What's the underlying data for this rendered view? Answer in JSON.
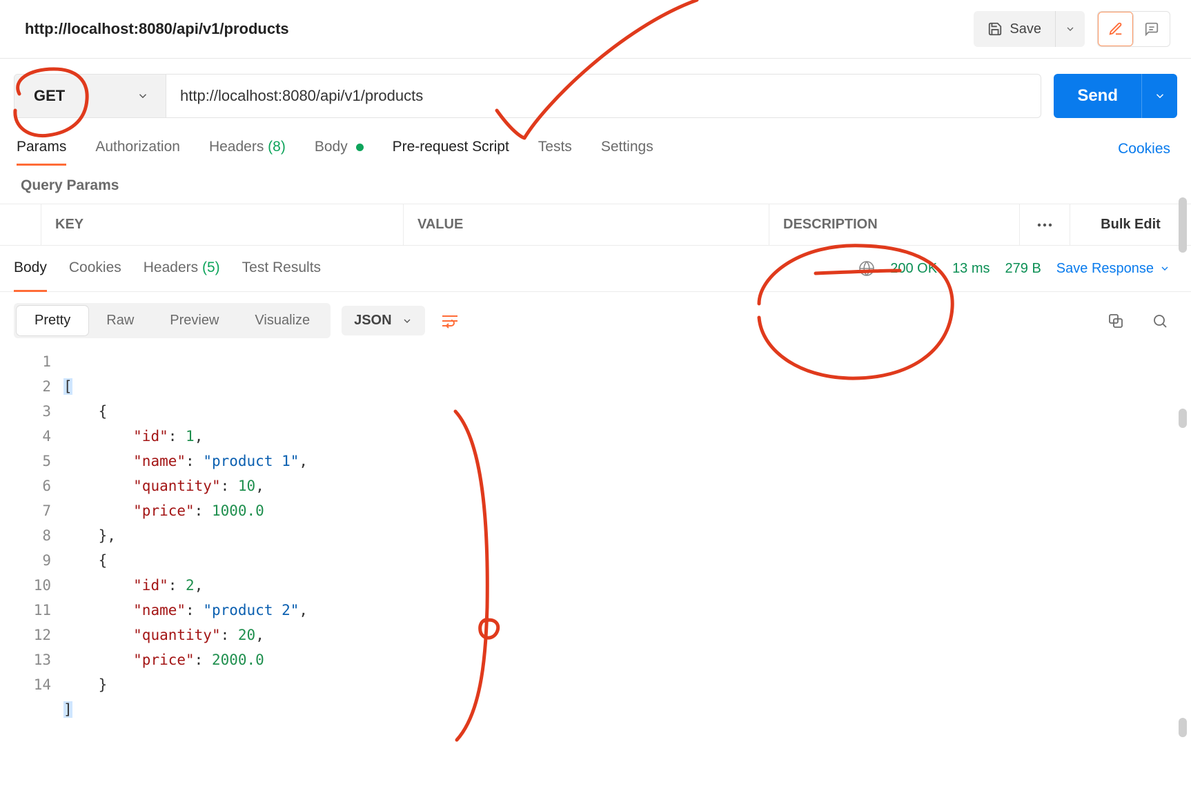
{
  "title": "http://localhost:8080/api/v1/products",
  "toolbar": {
    "save_label": "Save"
  },
  "request": {
    "method": "GET",
    "url": "http://localhost:8080/api/v1/products",
    "send_label": "Send"
  },
  "request_tabs": {
    "params": "Params",
    "authorization": "Authorization",
    "headers_label": "Headers",
    "headers_count": "(8)",
    "body": "Body",
    "prerequest": "Pre-request Script",
    "tests": "Tests",
    "settings": "Settings",
    "cookies_link": "Cookies"
  },
  "query_params": {
    "title": "Query Params",
    "key": "KEY",
    "value": "VALUE",
    "description": "DESCRIPTION",
    "bulk_edit": "Bulk Edit"
  },
  "response_tabs": {
    "body": "Body",
    "cookies": "Cookies",
    "headers_label": "Headers",
    "headers_count": "(5)",
    "test_results": "Test Results"
  },
  "response_status": {
    "status": "200 OK",
    "time": "13 ms",
    "size": "279 B",
    "save_response": "Save Response"
  },
  "body_view": {
    "pretty": "Pretty",
    "raw": "Raw",
    "preview": "Preview",
    "visualize": "Visualize",
    "format": "JSON"
  },
  "code": {
    "lines": [
      "1",
      "2",
      "3",
      "4",
      "5",
      "6",
      "7",
      "8",
      "9",
      "10",
      "11",
      "12",
      "13",
      "14"
    ],
    "l1_brace": "[",
    "l2_brace": "{",
    "l3_k": "\"id\"",
    "l3_v": "1",
    "l4_k": "\"name\"",
    "l4_v": "\"product 1\"",
    "l5_k": "\"quantity\"",
    "l5_v": "10",
    "l6_k": "\"price\"",
    "l6_v": "1000.0",
    "l7_brace": "},",
    "l8_brace": "{",
    "l9_k": "\"id\"",
    "l9_v": "2",
    "l10_k": "\"name\"",
    "l10_v": "\"product 2\"",
    "l11_k": "\"quantity\"",
    "l11_v": "20",
    "l12_k": "\"price\"",
    "l12_v": "2000.0",
    "l13_brace": "}",
    "l14_brace": "]"
  },
  "response_json": [
    {
      "id": 1,
      "name": "product 1",
      "quantity": 10,
      "price": 1000.0
    },
    {
      "id": 2,
      "name": "product 2",
      "quantity": 20,
      "price": 2000.0
    }
  ]
}
